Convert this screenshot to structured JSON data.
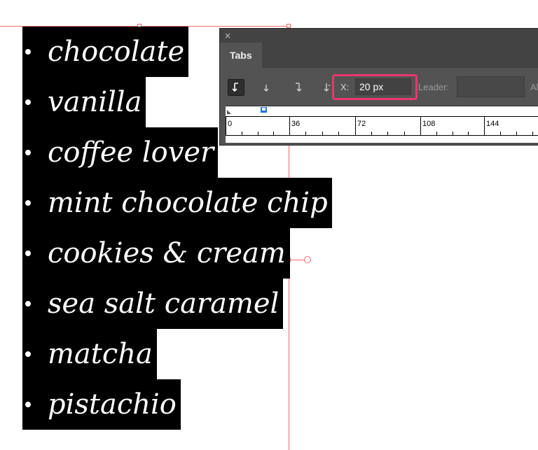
{
  "canvas": {
    "list_items": [
      "chocolate",
      "vanilla",
      "coffee lover",
      "mint chocolate chip",
      "cookies & cream",
      "sea salt caramel",
      "matcha",
      "pistachio"
    ],
    "colors": {
      "guide": "#f06a6a",
      "highlight": "#000000",
      "text": "#ffffff"
    }
  },
  "tabs_panel": {
    "close_icon": "×",
    "tab_label": "Tabs",
    "align_buttons": [
      {
        "name": "left-justified-tab",
        "icon": "↓",
        "selected": true
      },
      {
        "name": "center-justified-tab",
        "icon": "↓",
        "selected": false
      },
      {
        "name": "right-justified-tab",
        "icon": "↓",
        "selected": false
      },
      {
        "name": "align-to-decimal-tab",
        "icon": "↓",
        "selected": false
      }
    ],
    "x_label": "X:",
    "x_value": "20 px",
    "leader_label": "Leader:",
    "leader_value": "",
    "align_on_label": "Al",
    "ruler_labels": [
      "0",
      "36",
      "72",
      "108",
      "144"
    ],
    "colors": {
      "panel": "#535353",
      "highlight_box": "#e8386d",
      "tab_marker": "#1a73e8"
    }
  }
}
